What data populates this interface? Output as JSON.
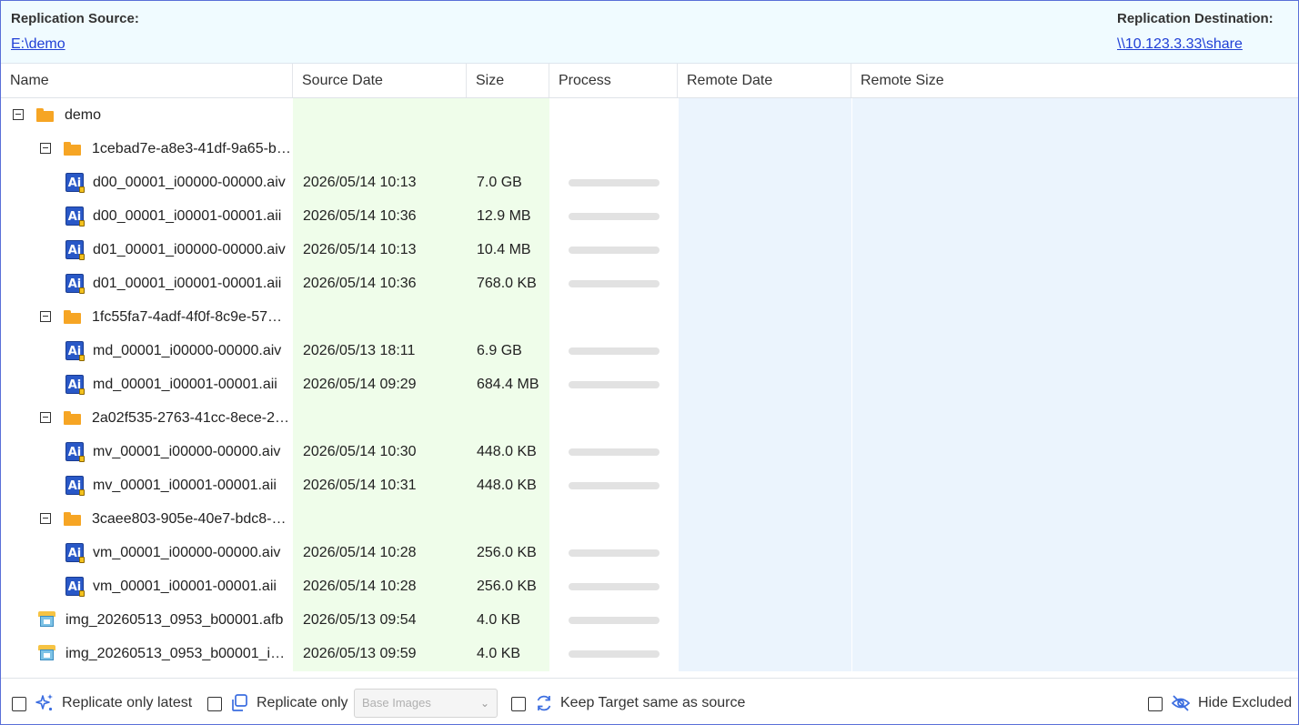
{
  "header": {
    "source_label": "Replication Source:",
    "source_path": "E:\\demo",
    "dest_label": "Replication Destination:",
    "dest_path": "\\\\10.123.3.33\\share"
  },
  "columns": {
    "name": "Name",
    "source_date": "Source Date",
    "size": "Size",
    "process": "Process",
    "remote_date": "Remote Date",
    "remote_size": "Remote Size"
  },
  "rows": [
    {
      "kind": "folder",
      "level": 0,
      "expanded": true,
      "name": "demo",
      "date": "",
      "size": ""
    },
    {
      "kind": "folder",
      "level": 1,
      "expanded": true,
      "name": "1cebad7e-a8e3-41df-9a65-b…",
      "date": "",
      "size": ""
    },
    {
      "kind": "ai",
      "level": 2,
      "name": "d00_00001_i00000-00000.aiv",
      "date": "2026/05/14 10:13",
      "size": "7.0 GB",
      "progress": 0
    },
    {
      "kind": "ai",
      "level": 2,
      "name": "d00_00001_i00001-00001.aii",
      "date": "2026/05/14 10:36",
      "size": "12.9 MB",
      "progress": 0
    },
    {
      "kind": "ai",
      "level": 2,
      "name": "d01_00001_i00000-00000.aiv",
      "date": "2026/05/14 10:13",
      "size": "10.4 MB",
      "progress": 0
    },
    {
      "kind": "ai",
      "level": 2,
      "name": "d01_00001_i00001-00001.aii",
      "date": "2026/05/14 10:36",
      "size": "768.0 KB",
      "progress": 0
    },
    {
      "kind": "folder",
      "level": 1,
      "expanded": true,
      "name": "1fc55fa7-4adf-4f0f-8c9e-57…",
      "date": "",
      "size": ""
    },
    {
      "kind": "ai",
      "level": 2,
      "name": "md_00001_i00000-00000.aiv",
      "date": "2026/05/13 18:11",
      "size": "6.9 GB",
      "progress": 0
    },
    {
      "kind": "ai",
      "level": 2,
      "name": "md_00001_i00001-00001.aii",
      "date": "2026/05/14 09:29",
      "size": "684.4 MB",
      "progress": 0
    },
    {
      "kind": "folder",
      "level": 1,
      "expanded": true,
      "name": "2a02f535-2763-41cc-8ece-2…",
      "date": "",
      "size": ""
    },
    {
      "kind": "ai",
      "level": 2,
      "name": "mv_00001_i00000-00000.aiv",
      "date": "2026/05/14 10:30",
      "size": "448.0 KB",
      "progress": 0
    },
    {
      "kind": "ai",
      "level": 2,
      "name": "mv_00001_i00001-00001.aii",
      "date": "2026/05/14 10:31",
      "size": "448.0 KB",
      "progress": 0
    },
    {
      "kind": "folder",
      "level": 1,
      "expanded": true,
      "name": "3caee803-905e-40e7-bdc8-…",
      "date": "",
      "size": ""
    },
    {
      "kind": "ai",
      "level": 2,
      "name": "vm_00001_i00000-00000.aiv",
      "date": "2026/05/14 10:28",
      "size": "256.0 KB",
      "progress": 0
    },
    {
      "kind": "ai",
      "level": 2,
      "name": "vm_00001_i00001-00001.aii",
      "date": "2026/05/14 10:28",
      "size": "256.0 KB",
      "progress": 0
    },
    {
      "kind": "afb",
      "level": 1,
      "name": "img_20260513_0953_b00001.afb",
      "date": "2026/05/13 09:54",
      "size": "4.0 KB",
      "progress": 0
    },
    {
      "kind": "afb",
      "level": 1,
      "name": "img_20260513_0953_b00001_i…",
      "date": "2026/05/13 09:59",
      "size": "4.0 KB",
      "progress": 0
    }
  ],
  "footer": {
    "replicate_latest_label": "Replicate only latest",
    "replicate_only_label": "Replicate only",
    "replicate_only_select": "Base Images",
    "keep_target_label": "Keep Target same as source",
    "hide_excluded_label": "Hide Excluded"
  },
  "colors": {
    "accent": "#1f3fd6",
    "source_column_bg": "#effdea",
    "remote_column_bg": "#ebf4fd",
    "folder": "#f6a524",
    "icon_blue": "#3b6de0"
  }
}
